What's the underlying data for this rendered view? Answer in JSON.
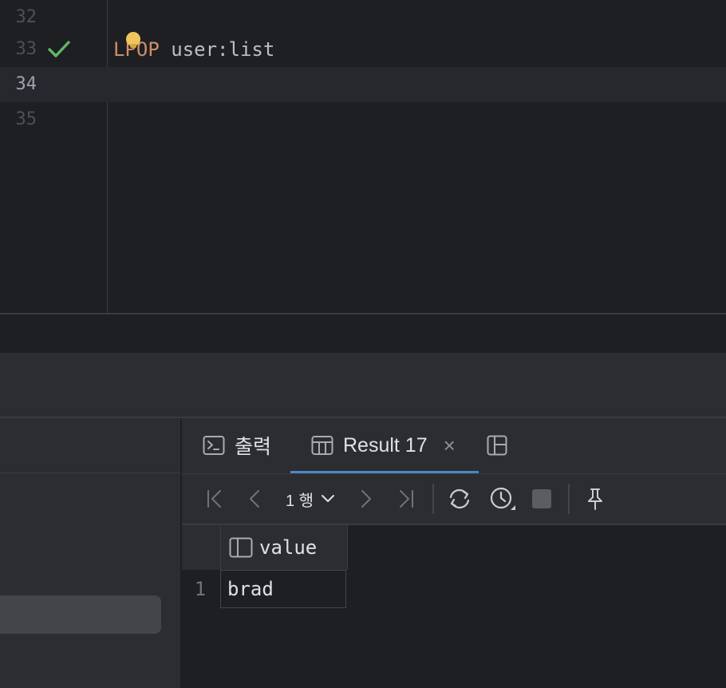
{
  "editor": {
    "lines": [
      {
        "number": "32",
        "code": ""
      },
      {
        "number": "33",
        "keyword": "LPOP",
        "args": "user:list",
        "status": "check-icon"
      },
      {
        "number": "34",
        "code": ""
      },
      {
        "number": "35",
        "code": ""
      }
    ]
  },
  "results": {
    "tabs": {
      "output_label": "출력",
      "result_label": "Result 17"
    },
    "toolbar": {
      "page_label": "1 행"
    },
    "grid": {
      "columns": [
        "value"
      ],
      "rows": [
        {
          "index": "1",
          "values": [
            "brad"
          ]
        }
      ]
    }
  },
  "colors": {
    "keyword": "#cf8e6d",
    "success": "#5fb865",
    "accent": "#4a88c7",
    "background": "#1e1f22"
  }
}
